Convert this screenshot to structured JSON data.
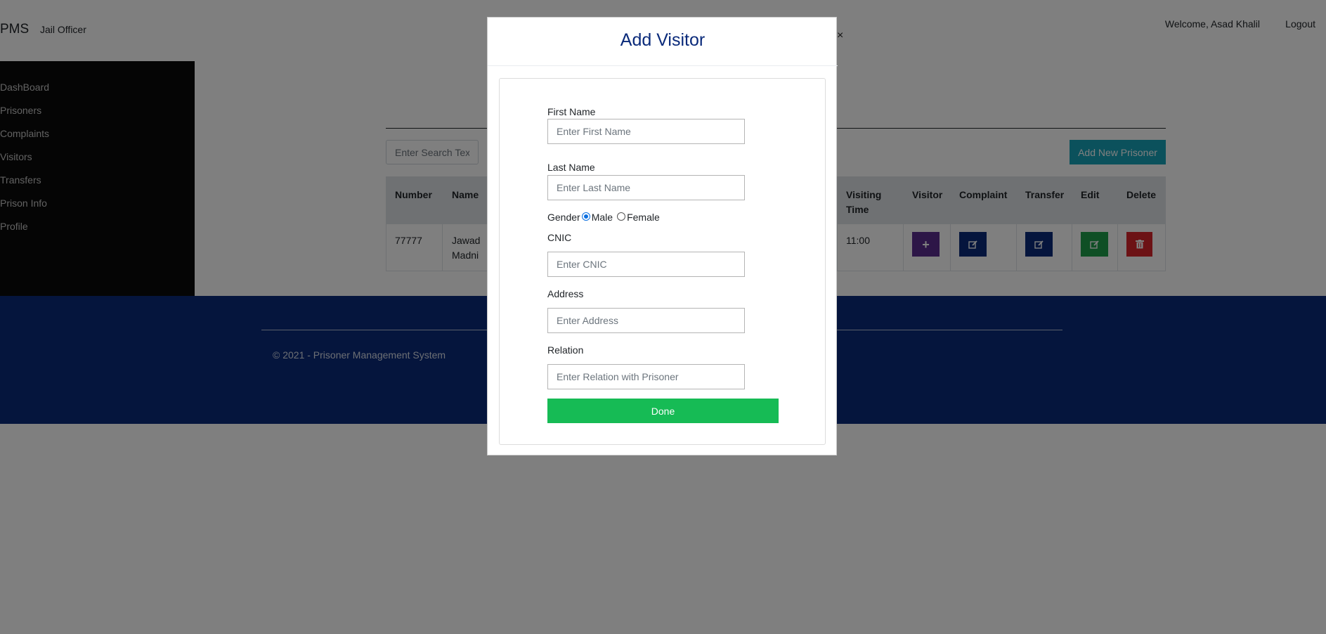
{
  "nav": {
    "brand": "PMS",
    "role": "Jail Officer",
    "welcome": "Welcome, Asad Khalil",
    "logout": "Logout"
  },
  "sidebar": {
    "items": [
      {
        "label": "DashBoard"
      },
      {
        "label": "Prisoners"
      },
      {
        "label": "Complaints"
      },
      {
        "label": "Visitors"
      },
      {
        "label": "Transfers"
      },
      {
        "label": "Prison Info"
      },
      {
        "label": "Profile"
      }
    ]
  },
  "main": {
    "search_placeholder": "Enter Search Text..",
    "add_button": "Add New Prisoner",
    "table": {
      "headers": {
        "number": "Number",
        "name": "Name",
        "visiting_time": "Visiting Time",
        "visitor": "Visitor",
        "complaint": "Complaint",
        "transfer": "Transfer",
        "edit": "Edit",
        "delete": "Delete"
      },
      "rows": [
        {
          "number": "77777",
          "name": "Jawad Madni",
          "visiting_time": "11:00"
        }
      ]
    }
  },
  "footer": {
    "copyright": "© 2021 - Prisoner Management System"
  },
  "modal": {
    "title": "Add Visitor",
    "close": "×",
    "fields": {
      "first_name_label": "First Name",
      "first_name_placeholder": "Enter First Name",
      "last_name_label": "Last Name",
      "last_name_placeholder": "Enter Last Name",
      "gender_label": "Gender",
      "gender_male": "Male",
      "gender_female": "Female",
      "gender_selected": "Male",
      "cnic_label": "CNIC",
      "cnic_placeholder": "Enter CNIC",
      "address_label": "Address",
      "address_placeholder": "Enter Address",
      "relation_label": "Relation",
      "relation_placeholder": "Enter Relation with Prisoner"
    },
    "done_button": "Done"
  },
  "colors": {
    "navy": "#0a2a7a",
    "info": "#17a2b8",
    "visitor_btn": "#5b2c8f",
    "complaint_btn": "#0a2a7a",
    "transfer_btn": "#0a2a7a",
    "edit_btn": "#1e9e4a",
    "delete_btn": "#d9252b",
    "done_btn": "#16bb55"
  }
}
